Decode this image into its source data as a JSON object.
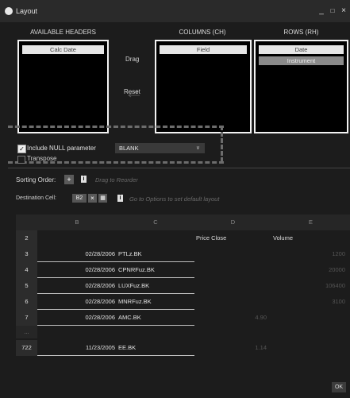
{
  "window": {
    "title": "Layout",
    "minimize": "_",
    "maximize": "□",
    "close": "×"
  },
  "headers": {
    "available_title": "AVAILABLE HEADERS",
    "columns_title": "COLUMNS (CH)",
    "rows_title": "ROWS (RH)",
    "available_items": [
      "Calc Date"
    ],
    "column_items": [
      "Field"
    ],
    "row_items": [
      "Date",
      "Instrument"
    ]
  },
  "actions": {
    "drag": "Drag",
    "reset": "Reset"
  },
  "options": {
    "include_null_label": "Include NULL parameter",
    "include_null_checked": true,
    "null_value": "BLANK",
    "transpose_label": "Transpose"
  },
  "sorting": {
    "label": "Sorting Order:",
    "add": "+",
    "info": "i",
    "hint": "Drag to Reorder"
  },
  "destination": {
    "label": "Destination Cell:",
    "cell": "B2",
    "info": "i",
    "hint": "Go to Options to set default layout"
  },
  "grid": {
    "column_headers": [
      "B",
      "C",
      "D",
      "E"
    ],
    "header_row": {
      "n": "2",
      "b": "",
      "c": "",
      "d": "Price Close",
      "e": "Volume"
    },
    "rows": [
      {
        "n": "3",
        "b": "02/28/2006",
        "c": "PTLz.BK",
        "d": "",
        "e": "1200"
      },
      {
        "n": "4",
        "b": "02/28/2006",
        "c": "CPNRFuz.BK",
        "d": "",
        "e": "20000"
      },
      {
        "n": "5",
        "b": "02/28/2006",
        "c": "LUXFuz.BK",
        "d": "",
        "e": "106400"
      },
      {
        "n": "6",
        "b": "02/28/2006",
        "c": "MNRFuz.BK",
        "d": "",
        "e": "3100"
      },
      {
        "n": "7",
        "b": "02/28/2006",
        "c": "AMC.BK",
        "d": "4.90",
        "e": ""
      }
    ],
    "ellipsis": "...",
    "last_row": {
      "n": "722",
      "b": "11/23/2005",
      "c": "EE.BK",
      "d": "1.14",
      "e": ""
    }
  },
  "footer": {
    "ok": "OK"
  }
}
